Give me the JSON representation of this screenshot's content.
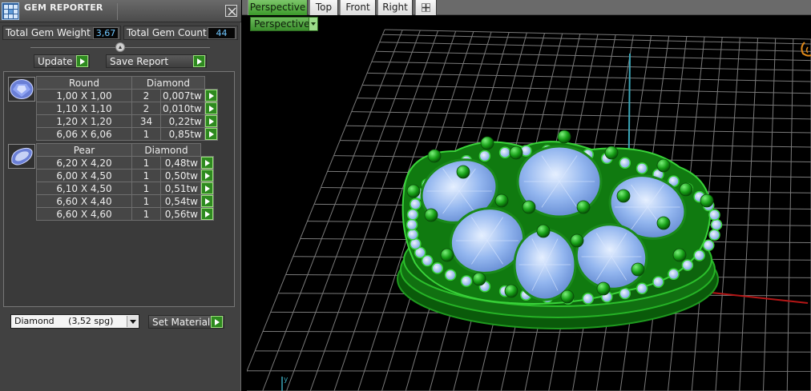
{
  "panel": {
    "title": "GEM REPORTER",
    "total_weight_label": "Total Gem Weight",
    "total_weight_value": "3,67",
    "total_count_label": "Total Gem Count",
    "total_count_value": "44",
    "update_label": "Update",
    "save_report_label": "Save Report",
    "groups": [
      {
        "shape": "Round",
        "material": "Diamond",
        "icon": "round-gem-icon",
        "rows": [
          {
            "size": "1,00 X 1,00",
            "count": "2",
            "weight": "0,007tw"
          },
          {
            "size": "1,10 X 1,10",
            "count": "2",
            "weight": "0,010tw"
          },
          {
            "size": "1,20 X 1,20",
            "count": "34",
            "weight": "0,22tw"
          },
          {
            "size": "6,06 X 6,06",
            "count": "1",
            "weight": "0,85tw"
          }
        ]
      },
      {
        "shape": "Pear",
        "material": "Diamond",
        "icon": "pear-gem-icon",
        "rows": [
          {
            "size": "6,20 X 4,20",
            "count": "1",
            "weight": "0,48tw"
          },
          {
            "size": "6,00 X 4,50",
            "count": "1",
            "weight": "0,50tw"
          },
          {
            "size": "6,10 X 4,50",
            "count": "1",
            "weight": "0,51tw"
          },
          {
            "size": "6,60 X 4,40",
            "count": "1",
            "weight": "0,54tw"
          },
          {
            "size": "6,60 X 4,60",
            "count": "1",
            "weight": "0,56tw"
          }
        ]
      }
    ],
    "material_select_value": "Diamond     (3,52 spg)",
    "set_material_label": "Set Material"
  },
  "viewport": {
    "tabs": [
      "Perspective",
      "Top",
      "Front",
      "Right"
    ],
    "active_tab": "Perspective",
    "view_dropdown": "Perspective",
    "add_tab_icon": "plus-icon"
  },
  "colors": {
    "accent_green": "#3c9a2b",
    "value_blue": "#6fc7ff",
    "model_green": "#1d8c1d",
    "gem_blue": "#8fb4ef"
  }
}
